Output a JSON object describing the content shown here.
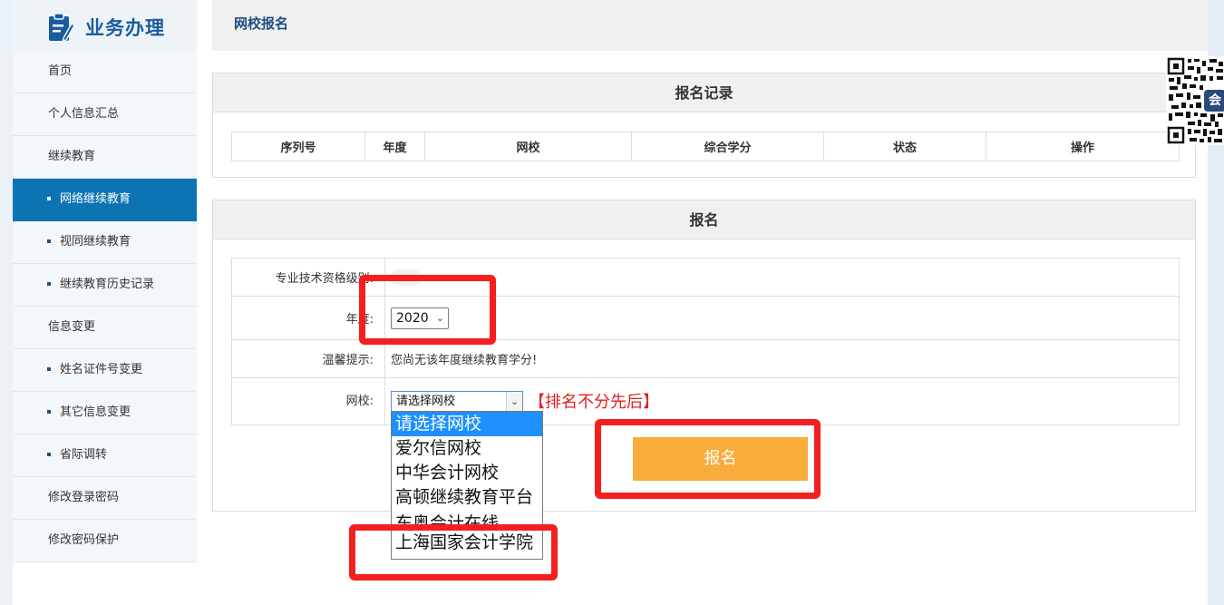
{
  "sidebar": {
    "title": "业务办理",
    "items": [
      {
        "label": "首页"
      },
      {
        "label": "个人信息汇总"
      },
      {
        "label": "继续教育"
      },
      {
        "label": "网络继续教育"
      },
      {
        "label": "视同继续教育"
      },
      {
        "label": "继续教育历史记录"
      },
      {
        "label": "信息变更"
      },
      {
        "label": "姓名证件号变更"
      },
      {
        "label": "其它信息变更"
      },
      {
        "label": "省际调转"
      },
      {
        "label": "修改登录密码"
      },
      {
        "label": "修改密码保护"
      }
    ]
  },
  "header": {
    "title": "网校报名"
  },
  "records": {
    "title": "报名记录",
    "columns": [
      "序列号",
      "年度",
      "网校",
      "综合学分",
      "状态",
      "操作"
    ]
  },
  "form": {
    "title": "报名",
    "level_label": "专业技术资格级别:",
    "year_label": "年度:",
    "year_value": "2020",
    "tip_label": "温馨提示:",
    "tip_text": "您尚无该年度继续教育学分!",
    "school_label": "网校:",
    "school_value": "请选择网校",
    "school_note": "【排名不分先后】",
    "school_options": [
      "请选择网校",
      "爱尔信网校",
      "中华会计网校",
      "高顿继续教育平台",
      "东奥会计在线",
      "上海国家会计学院"
    ],
    "submit_label": "报名"
  },
  "qr": {
    "badge": "会"
  },
  "colors": {
    "accent": "#0d74b4",
    "button": "#f7ac3b",
    "highlight": "#f41f1f",
    "note": "#e02020"
  }
}
